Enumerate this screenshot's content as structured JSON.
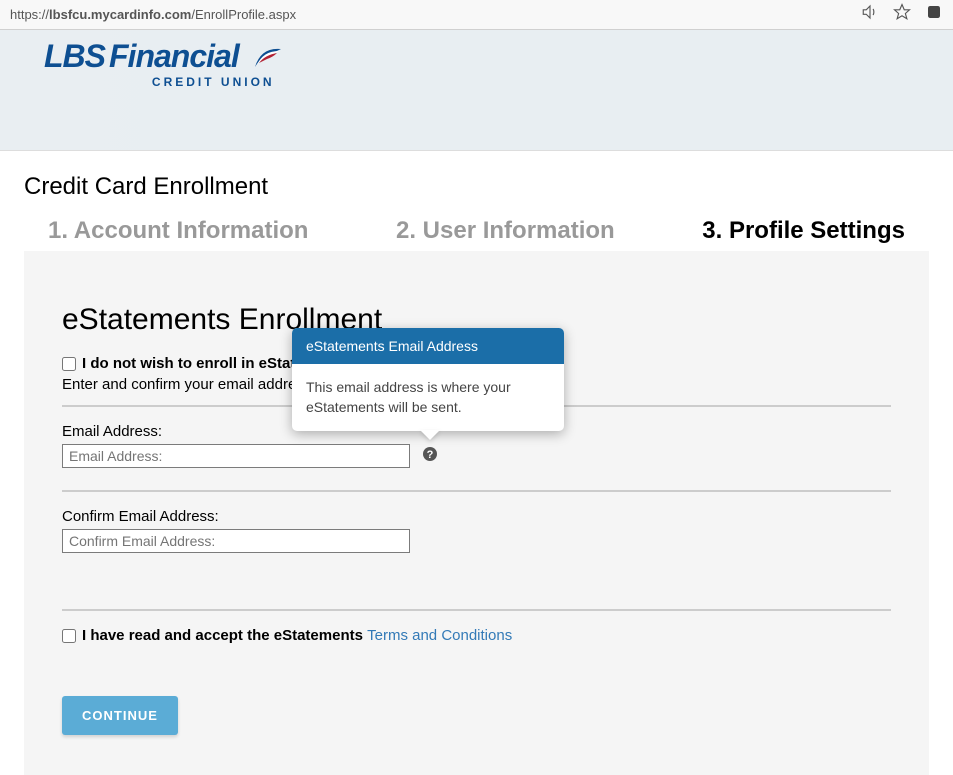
{
  "browser": {
    "url_prefix": "https://",
    "url_host": "lbsfcu.mycardinfo.com",
    "url_path": "/EnrollProfile.aspx"
  },
  "logo": {
    "main": "LBS",
    "secondary": "Financial",
    "subtitle": "CREDIT UNION"
  },
  "page": {
    "title": "Credit Card Enrollment"
  },
  "steps": [
    {
      "label": "1.  Account Information",
      "active": false
    },
    {
      "label": "2.  User Information",
      "active": false
    },
    {
      "label": "3.  Profile Settings",
      "active": true
    }
  ],
  "section": {
    "title": "eStatements Enrollment",
    "optout_label": "I do not wish to enroll in eStatements",
    "instruction": "Enter and confirm your email address:"
  },
  "fields": {
    "email": {
      "label": "Email Address:",
      "placeholder": "Email Address:",
      "value": ""
    },
    "confirm_email": {
      "label": "Confirm Email Address:",
      "placeholder": "Confirm Email Address:",
      "value": ""
    }
  },
  "tooltip": {
    "title": "eStatements Email Address",
    "body": "This email address is where your eStatements will be sent."
  },
  "terms": {
    "prefix": "I have read and accept the eStatements ",
    "link_text": "Terms and Conditions"
  },
  "buttons": {
    "continue": "CONTINUE"
  }
}
